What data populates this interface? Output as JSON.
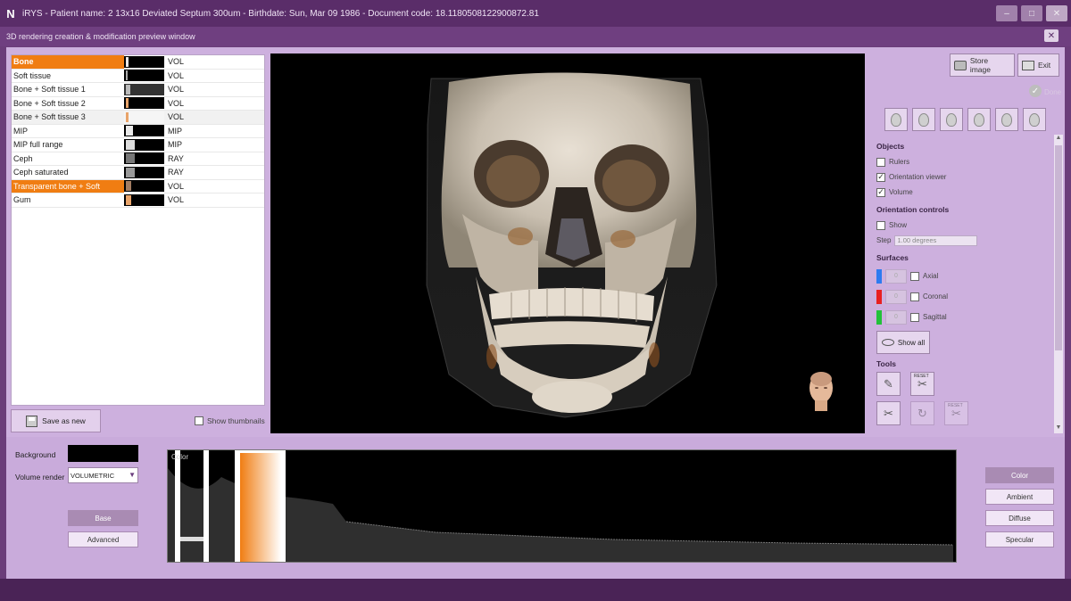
{
  "window": {
    "logo": "N",
    "title": "iRYS - Patient name: 2 13x16 Deviated Septum 300um - Birthdate: Sun, Mar 09 1986 - Document code: 18.1180508122900872.81",
    "subtitle": "3D rendering creation & modification preview window"
  },
  "presets": {
    "items": [
      {
        "name": "Bone",
        "type": "VOL"
      },
      {
        "name": "Soft tissue",
        "type": "VOL"
      },
      {
        "name": "Bone + Soft tissue 1",
        "type": "VOL"
      },
      {
        "name": "Bone + Soft tissue 2",
        "type": "VOL"
      },
      {
        "name": "Bone + Soft tissue 3",
        "type": "VOL"
      },
      {
        "name": "MIP",
        "type": "MIP"
      },
      {
        "name": "MIP full range",
        "type": "MIP"
      },
      {
        "name": "Ceph",
        "type": "RAY"
      },
      {
        "name": "Ceph saturated",
        "type": "RAY"
      },
      {
        "name": "Transparent bone + Soft",
        "type": "VOL"
      },
      {
        "name": "Gum",
        "type": "VOL"
      }
    ],
    "save_label": "Save as new",
    "show_thumbnails_label": "Show thumbnails"
  },
  "right": {
    "store_label": "Store image",
    "exit_label": "Exit",
    "done_label": "Done",
    "objects_title": "Objects",
    "objects": [
      {
        "label": "Rulers",
        "checked": ""
      },
      {
        "label": "Orientation viewer",
        "checked": "✓"
      },
      {
        "label": "Volume",
        "checked": "✓"
      }
    ],
    "orientation_title": "Orientation controls",
    "orientation_show": "Show",
    "step_label": "Step",
    "step_value": "1.00 degrees",
    "surfaces_title": "Surfaces",
    "surfaces": [
      {
        "label": "Axial",
        "color": "#2d7bf0",
        "value": "0"
      },
      {
        "label": "Coronal",
        "color": "#e82020",
        "value": "0"
      },
      {
        "label": "Sagittal",
        "color": "#22c13a",
        "value": "0"
      }
    ],
    "show_all_label": "Show all",
    "tools_title": "Tools",
    "reset_label": "RESET"
  },
  "bottom": {
    "background_label": "Background",
    "volume_render_label": "Volume render",
    "volume_render_value": "VOLUMETRIC",
    "base_label": "Base",
    "advanced_label": "Advanced",
    "histo_label": "Color",
    "side_buttons": [
      "Color",
      "Ambient",
      "Diffuse",
      "Specular"
    ],
    "accent": "#f07d12"
  }
}
